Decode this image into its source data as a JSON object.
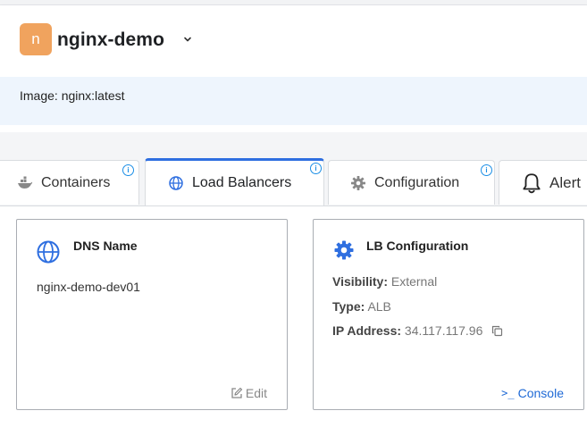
{
  "app": {
    "badge_letter": "n",
    "name": "nginx-demo",
    "badge_color": "#f0a35e"
  },
  "image_bar": {
    "text": "Image: nginx:latest"
  },
  "tabs": [
    {
      "label": "Containers",
      "icon": "docker-icon",
      "info": "i"
    },
    {
      "label": "Load Balancers",
      "icon": "globe-icon",
      "info": "i",
      "active": true
    },
    {
      "label": "Configuration",
      "icon": "gear-icon",
      "info": "i"
    },
    {
      "label": "Alert",
      "icon": "bell-icon"
    }
  ],
  "dns_card": {
    "title": "DNS Name",
    "value": "nginx-demo-dev01",
    "edit_label": "Edit"
  },
  "lb_card": {
    "title": "LB Configuration",
    "visibility_label": "Visibility:",
    "visibility_value": "External",
    "type_label": "Type:",
    "type_value": "ALB",
    "ip_label": "IP Address:",
    "ip_value": "34.117.117.96",
    "console_prompt": ">_",
    "console_label": "Console"
  },
  "colors": {
    "accent": "#2f6fe0",
    "link": "#1f6ad6",
    "info": "#1b8ee6",
    "image_bar_bg": "#eef5fd"
  }
}
